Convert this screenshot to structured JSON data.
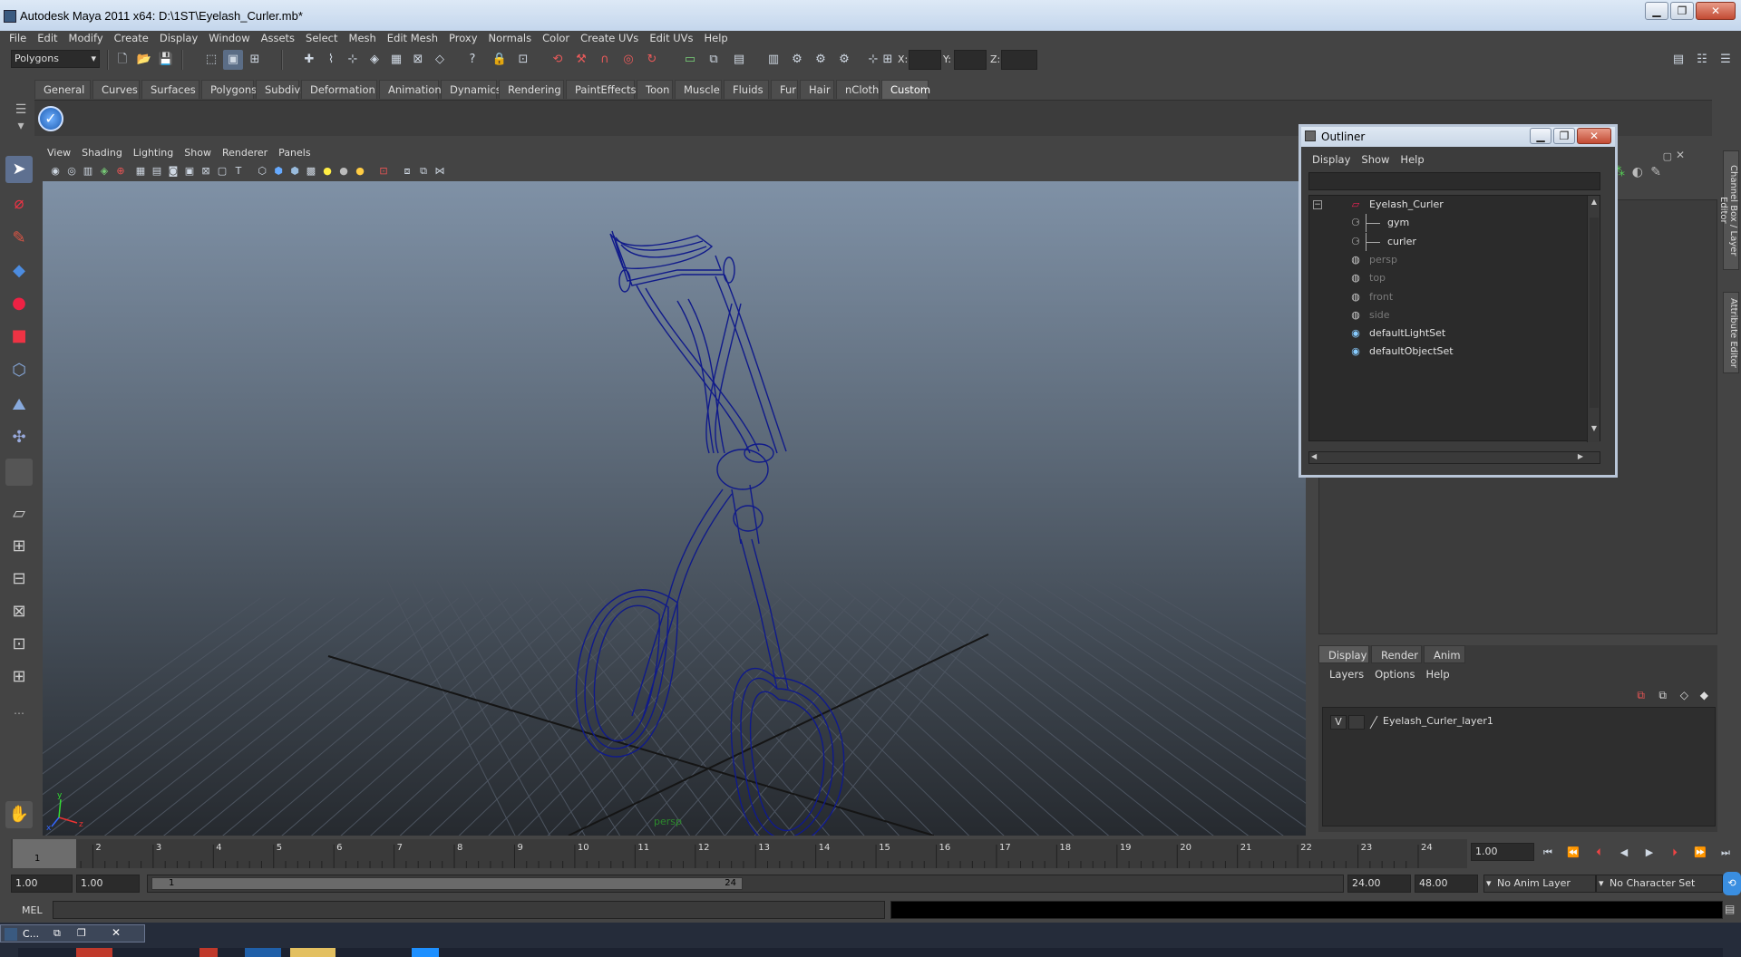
{
  "window": {
    "title": "Autodesk Maya 2011 x64: D:\\1ST\\Eyelash_Curler.mb*"
  },
  "menu": [
    "File",
    "Edit",
    "Modify",
    "Create",
    "Display",
    "Window",
    "Assets",
    "Select",
    "Mesh",
    "Edit Mesh",
    "Proxy",
    "Normals",
    "Color",
    "Create UVs",
    "Edit UVs",
    "Help"
  ],
  "status": {
    "mode": "Polygons",
    "x_label": "X:",
    "y_label": "Y:",
    "z_label": "Z:"
  },
  "shelf_tabs": [
    "General",
    "Curves",
    "Surfaces",
    "Polygons",
    "Subdivs",
    "Deformation",
    "Animation",
    "Dynamics",
    "Rendering",
    "PaintEffects",
    "Toon",
    "Muscle",
    "Fluids",
    "Fur",
    "Hair",
    "nCloth",
    "Custom"
  ],
  "shelf_active": "Custom",
  "viewport": {
    "menu": [
      "View",
      "Shading",
      "Lighting",
      "Show",
      "Renderer",
      "Panels"
    ],
    "camera_label": "persp"
  },
  "outliner": {
    "title": "Outliner",
    "menu": [
      "Display",
      "Show",
      "Help"
    ],
    "items": [
      {
        "label": "Eyelash_Curler",
        "level": 0,
        "dim": false,
        "icon": "group-icon"
      },
      {
        "label": "gym",
        "level": 1,
        "dim": false,
        "icon": "mesh-icon"
      },
      {
        "label": "curler",
        "level": 1,
        "dim": false,
        "icon": "mesh-icon"
      },
      {
        "label": "persp",
        "level": 0,
        "dim": true,
        "icon": "camera-icon"
      },
      {
        "label": "top",
        "level": 0,
        "dim": true,
        "icon": "camera-icon"
      },
      {
        "label": "front",
        "level": 0,
        "dim": true,
        "icon": "camera-icon"
      },
      {
        "label": "side",
        "level": 0,
        "dim": true,
        "icon": "camera-icon"
      },
      {
        "label": "defaultLightSet",
        "level": 0,
        "dim": false,
        "icon": "set-icon"
      },
      {
        "label": "defaultObjectSet",
        "level": 0,
        "dim": false,
        "icon": "set-icon"
      }
    ]
  },
  "side_tabs": [
    "Channel Box / Layer Editor",
    "Attribute Editor"
  ],
  "layer_editor": {
    "tabs": [
      "Display",
      "Render",
      "Anim"
    ],
    "active_tab": "Display",
    "menu": [
      "Layers",
      "Options",
      "Help"
    ],
    "layers": [
      {
        "visible": "V",
        "name": "Eyelash_Curler_layer1"
      }
    ]
  },
  "time": {
    "ticks": [
      "1",
      "2",
      "3",
      "4",
      "5",
      "6",
      "7",
      "8",
      "9",
      "10",
      "11",
      "12",
      "13",
      "14",
      "15",
      "16",
      "17",
      "18",
      "19",
      "20",
      "21",
      "22",
      "23",
      "24"
    ],
    "current_frame": "1",
    "current_field": "1.00",
    "range_start": "1.00",
    "range_start2": "1.00",
    "range_inner_start": "1",
    "range_inner_end": "24",
    "range_end": "24.00",
    "range_end2": "48.00",
    "anim_layer": "No Anim Layer",
    "char_set": "No Character Set"
  },
  "command": {
    "label": "MEL"
  },
  "taskbar": {
    "task_label": "C..."
  }
}
